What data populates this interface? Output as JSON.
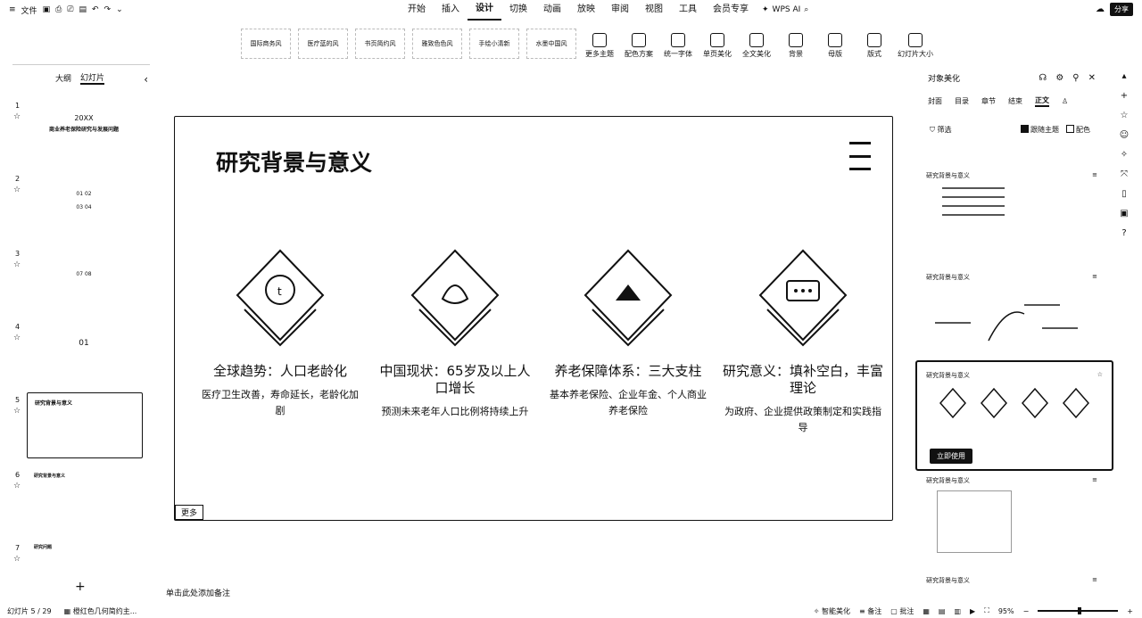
{
  "menubar": {
    "file": "文件",
    "tabs": [
      "开始",
      "插入",
      "设计",
      "切换",
      "动画",
      "放映",
      "审阅",
      "视图",
      "工具",
      "会员专享"
    ],
    "active_tab": "设计",
    "wps_ai": "WPS AI",
    "share": "分享"
  },
  "ribbon": {
    "themes": [
      "国际商务风",
      "医疗蓝的风",
      "书页简约风",
      "雅致色色风",
      "手绘小清新",
      "水墨中国风"
    ],
    "tools": [
      "更多主题",
      "配色方案",
      "统一字体",
      "单页美化",
      "全文美化",
      "背景",
      "母版",
      "版式",
      "幻灯片大小"
    ]
  },
  "left_panel": {
    "tabs": [
      "大纲",
      "幻灯片"
    ],
    "active_tab": "幻灯片",
    "slides": [
      {
        "num": "1",
        "line1": "20XX",
        "line2": "商业养老保险研究与发展问题"
      },
      {
        "num": "2",
        "line1": "01  02",
        "line2": "03  04"
      },
      {
        "num": "3",
        "line1": "07  08",
        "line2": ""
      },
      {
        "num": "4",
        "line1": "01",
        "line2": ""
      },
      {
        "num": "5",
        "line1": "研究背景与意义",
        "line2": ""
      },
      {
        "num": "6",
        "line1": "研究背景与意义",
        "line2": ""
      },
      {
        "num": "7",
        "line1": "研究问题",
        "line2": ""
      }
    ],
    "selected_slide": "5"
  },
  "slide": {
    "title": "研究背景与意义",
    "cards": [
      {
        "heading": "全球趋势：人口老龄化",
        "body": "医疗卫生改善，寿命延长，老龄化加剧"
      },
      {
        "heading": "中国现状：65岁及以上人口增长",
        "body": "预测未来老年人口比例将持续上升"
      },
      {
        "heading": "养老保障体系：三大支柱",
        "body": "基本养老保险、企业年金、个人商业养老保险"
      },
      {
        "heading": "研究意义：填补空白，丰富理论",
        "body": "为政府、企业提供政策制定和实践指导"
      }
    ],
    "pager": "更多"
  },
  "notes_hint": "单击此处添加备注",
  "right_panel": {
    "title": "对象美化",
    "tabs": [
      "封面",
      "目录",
      "章节",
      "结束",
      "正文"
    ],
    "active_tab": "正文",
    "filter": "筛选",
    "check_theme": "跟随主题",
    "check_color": "配色",
    "templates": [
      {
        "name": "研究背景与意义"
      },
      {
        "name": "研究背景与意义"
      },
      {
        "name": "研究背景与意义"
      },
      {
        "name": "研究背景与意义"
      },
      {
        "name": "研究背景与意义"
      }
    ],
    "use_button": "立即使用"
  },
  "statusbar": {
    "slide_count": "幻灯片 5 / 29",
    "theme_name": "橙红色几何简约主...",
    "smart_beautify": "智能美化",
    "notes": "备注",
    "comments": "批注",
    "zoom": "95%",
    "zoom_fraction": 0.5
  }
}
